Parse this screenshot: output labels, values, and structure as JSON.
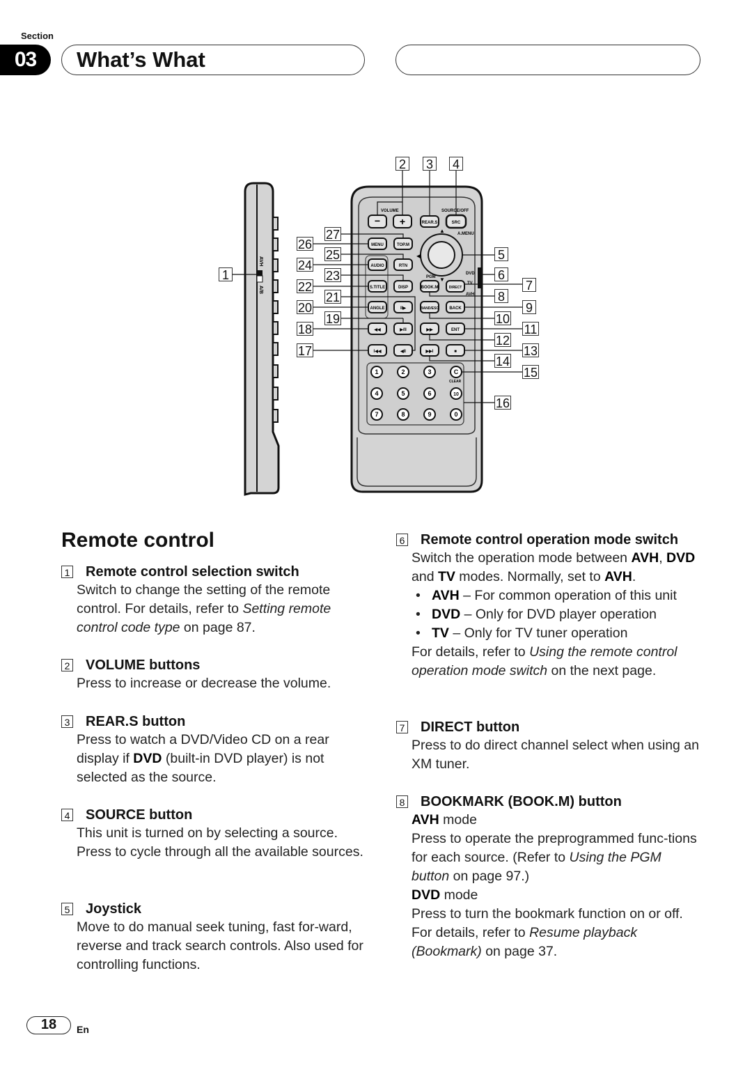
{
  "header": {
    "section_label": "Section",
    "section_number": "03",
    "title": "What’s What"
  },
  "diagram": {
    "callouts": [
      "1",
      "2",
      "3",
      "4",
      "5",
      "6",
      "7",
      "8",
      "9",
      "10",
      "11",
      "12",
      "13",
      "14",
      "15",
      "16",
      "17",
      "18",
      "19",
      "20",
      "21",
      "22",
      "23",
      "24",
      "25",
      "26",
      "27"
    ],
    "side_switch_labels": {
      "top": "AVH",
      "bottom": "A/B"
    },
    "remote_labels": {
      "volume": "VOLUME",
      "source_off": "SOURCE/OFF",
      "a_menu": "A.MENU",
      "pgm": "PGM",
      "clear": "CLEAR",
      "mode_dvd": "DVD",
      "mode_tv": "TV",
      "mode_avh": "AVH"
    },
    "buttons": {
      "vol_minus": "−",
      "vol_plus": "+",
      "rear_s": "REAR.S",
      "src": "SRC",
      "menu": "MENU",
      "top_m": "TOP.M",
      "audio": "AUDIO",
      "rtn": "RTN",
      "s_title": "S.TITLE",
      "disp": "DISP",
      "book_m": "BOOK.M",
      "direct": "DIRECT",
      "angle": "ANGLE",
      "slow_fwd": "II▶",
      "band_esc": "BAND/ESC",
      "back": "BACK",
      "rew": "◀◀",
      "play_pause": "▶/II",
      "ff": "▶▶",
      "ent": "ENT",
      "prev": "I◀◀",
      "slow_rev": "◀II",
      "next": "▶▶I",
      "stop": "■",
      "clear": "C",
      "keypad": [
        "1",
        "2",
        "3",
        "4",
        "5",
        "6",
        "10",
        "7",
        "8",
        "9",
        "0"
      ]
    }
  },
  "content": {
    "heading": "Remote control",
    "items": [
      {
        "num": "1",
        "title": "Remote control selection switch",
        "body": [
          "Switch to change the setting of the remote control. For details, refer to ",
          {
            "i": "Setting remote control code type"
          },
          " on page 87."
        ]
      },
      {
        "num": "2",
        "title": "VOLUME buttons",
        "body": [
          "Press to increase or decrease the volume."
        ]
      },
      {
        "num": "3",
        "title": "REAR.S button",
        "body": [
          "Press to watch a DVD/Video CD on a rear display if ",
          {
            "b": "DVD"
          },
          " (built-in DVD player) is not selected as the source."
        ]
      },
      {
        "num": "4",
        "title": "SOURCE button",
        "body": [
          "This unit is turned on by selecting a source. Press to cycle through all the available sources."
        ]
      },
      {
        "num": "5",
        "title": "Joystick",
        "body": [
          "Move to do manual seek tuning, fast for-ward, reverse and track search controls. Also used for controlling functions."
        ]
      },
      {
        "num": "6",
        "title": "Remote control operation mode switch",
        "body": [
          "Switch the operation mode between ",
          {
            "b": "AVH"
          },
          ", ",
          {
            "b": "DVD"
          },
          " and ",
          {
            "b": "TV"
          },
          " modes. Normally, set to ",
          {
            "b": "AVH"
          },
          "."
        ],
        "bullets": [
          [
            {
              "b": "AVH"
            },
            " – For common operation of this unit"
          ],
          [
            {
              "b": "DVD"
            },
            " – Only for DVD player operation"
          ],
          [
            {
              "b": "TV"
            },
            " – Only for TV tuner operation"
          ]
        ],
        "after": [
          "For details, refer to ",
          {
            "i": "Using the remote control operation mode switch"
          },
          " on the next page."
        ]
      },
      {
        "num": "7",
        "title": "DIRECT button",
        "body": [
          "Press to do direct channel select when using an XM tuner."
        ]
      },
      {
        "num": "8",
        "title": "BOOKMARK (BOOK.M) button",
        "body_blocks": [
          [
            {
              "b": "AVH"
            },
            " mode"
          ],
          [
            "Press to operate the preprogrammed func-tions for each source. (Refer to ",
            {
              "i": "Using the PGM button"
            },
            " on page 97.)"
          ],
          [
            {
              "b": "DVD"
            },
            " mode"
          ],
          [
            "Press to turn the bookmark function on or off. For details, refer to ",
            {
              "i": "Resume playback (Bookmark)"
            },
            " on page 37."
          ]
        ]
      }
    ]
  },
  "footer": {
    "page_number": "18",
    "language": "En"
  }
}
